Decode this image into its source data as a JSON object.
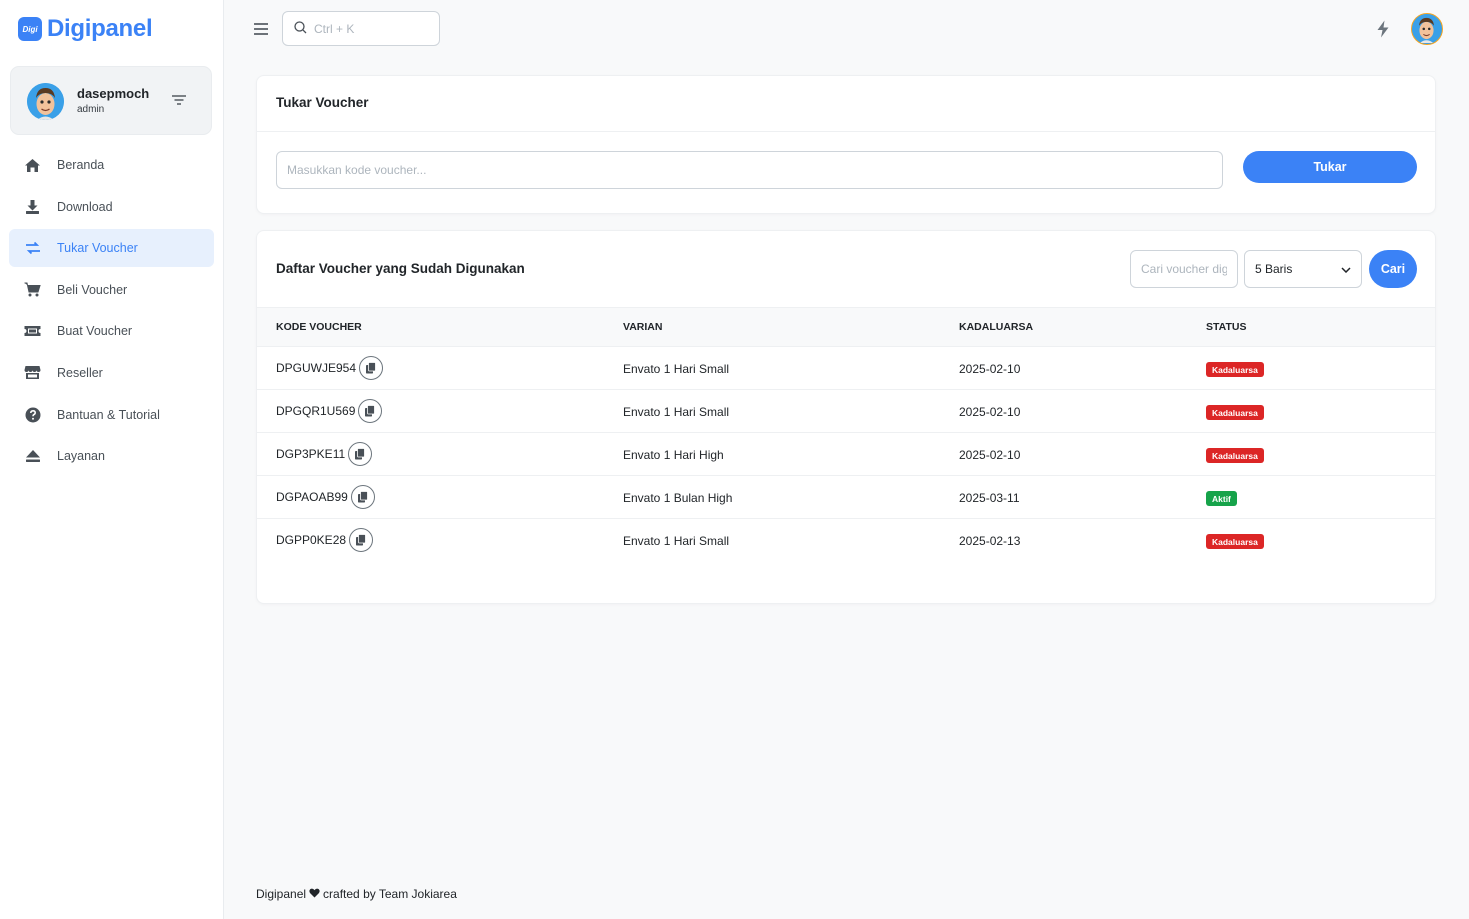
{
  "brand": {
    "badge": "Digi",
    "name": "Digipanel"
  },
  "user": {
    "name": "dasepmoch",
    "role": "admin"
  },
  "sidebar": {
    "items": [
      {
        "label": "Beranda",
        "icon": "home-icon"
      },
      {
        "label": "Download",
        "icon": "download-icon"
      },
      {
        "label": "Tukar Voucher",
        "icon": "exchange-icon",
        "active": true
      },
      {
        "label": "Beli Voucher",
        "icon": "cart-icon"
      },
      {
        "label": "Buat Voucher",
        "icon": "ticket-icon"
      },
      {
        "label": "Reseller",
        "icon": "store-icon"
      },
      {
        "label": "Bantuan & Tutorial",
        "icon": "help-icon"
      },
      {
        "label": "Layanan",
        "icon": "eject-icon"
      }
    ]
  },
  "topbar": {
    "search_placeholder": "Ctrl + K"
  },
  "redeem": {
    "title": "Tukar Voucher",
    "input_placeholder": "Masukkan kode voucher...",
    "button_label": "Tukar"
  },
  "used_list": {
    "title": "Daftar Voucher yang Sudah Digunakan",
    "search_placeholder": "Cari voucher digunakan",
    "rows_option": "5 Baris",
    "search_button": "Cari",
    "columns": [
      "KODE VOUCHER",
      "VARIAN",
      "KADALUARSA",
      "STATUS"
    ],
    "rows": [
      {
        "code": "DPGUWJE954",
        "variant": "Envato 1 Hari Small",
        "expiry": "2025-02-10",
        "status": "Kadaluarsa",
        "status_type": "expired"
      },
      {
        "code": "DPGQR1U569",
        "variant": "Envato 1 Hari Small",
        "expiry": "2025-02-10",
        "status": "Kadaluarsa",
        "status_type": "expired"
      },
      {
        "code": "DGP3PKE11",
        "variant": "Envato 1 Hari High",
        "expiry": "2025-02-10",
        "status": "Kadaluarsa",
        "status_type": "expired"
      },
      {
        "code": "DGPAOAB99",
        "variant": "Envato 1 Bulan High",
        "expiry": "2025-03-11",
        "status": "Aktif",
        "status_type": "active"
      },
      {
        "code": "DGPP0KE28",
        "variant": "Envato 1 Hari Small",
        "expiry": "2025-02-13",
        "status": "Kadaluarsa",
        "status_type": "expired"
      }
    ]
  },
  "footer": {
    "left": "Digipanel",
    "right": "crafted by Team Jokiarea"
  },
  "colors": {
    "primary": "#3b82f6",
    "danger": "#dc2626",
    "success": "#16a34a",
    "active_bg": "#e7f0fd"
  }
}
